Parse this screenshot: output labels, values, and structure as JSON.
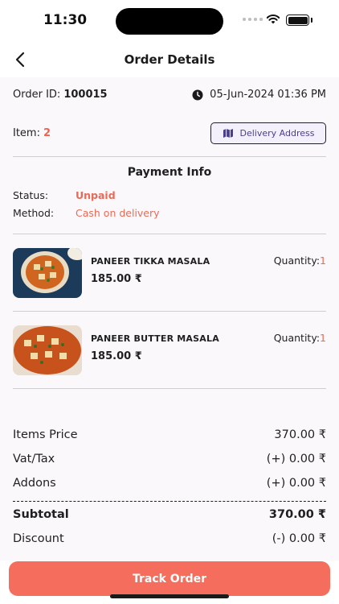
{
  "status_bar": {
    "time": "11:30"
  },
  "header": {
    "title": "Order Details"
  },
  "order": {
    "id_label": "Order ID:",
    "id": "100015",
    "date": "05-Jun-2024 01:36 PM",
    "item_label": "Item:",
    "item_count": "2",
    "delivery_button": "Delivery Address"
  },
  "payment": {
    "title": "Payment Info",
    "status_label": "Status:",
    "status_value": "Unpaid",
    "method_label": "Method:",
    "method_value": "Cash on delivery"
  },
  "items": [
    {
      "name": "PANEER TIKKA MASALA",
      "price": "185.00 ₹",
      "qty_label": "Quantity:",
      "qty": "1"
    },
    {
      "name": "PANEER BUTTER MASALA",
      "price": "185.00 ₹",
      "qty_label": "Quantity:",
      "qty": "1"
    }
  ],
  "summary": {
    "items_price_label": "Items Price",
    "items_price": "370.00 ₹",
    "tax_label": "Vat/Tax",
    "tax": "(+) 0.00 ₹",
    "addons_label": "Addons",
    "addons": "(+) 0.00 ₹",
    "subtotal_label": "Subtotal",
    "subtotal": "370.00 ₹",
    "discount_label": "Discount",
    "discount": "(-) 0.00 ₹"
  },
  "footer": {
    "track_button": "Track Order"
  },
  "colors": {
    "accent": "#f46d5d",
    "status_text": "#ea6a55",
    "background": "#fbf8fc"
  }
}
